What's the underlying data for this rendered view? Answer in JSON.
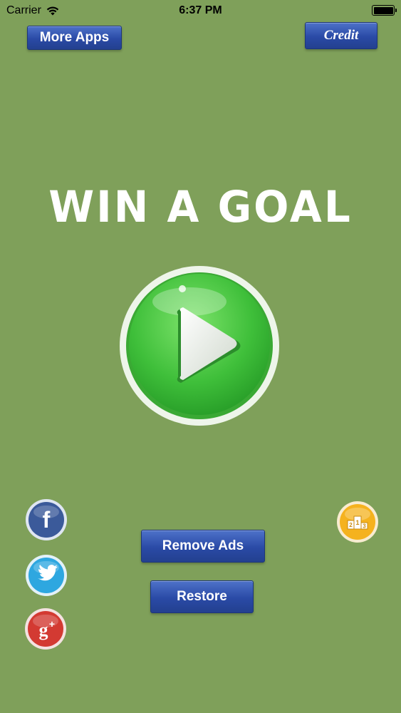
{
  "status_bar": {
    "carrier": "Carrier",
    "time": "6:37 PM"
  },
  "top_buttons": {
    "more_apps_label": "More Apps",
    "credit_label": "Credit"
  },
  "game": {
    "title": "WIN A GOAL"
  },
  "bottom_buttons": {
    "remove_ads_label": "Remove Ads",
    "restore_label": "Restore"
  },
  "icons": {
    "facebook": "facebook-icon",
    "twitter": "twitter-icon",
    "google_plus": "google-plus-icon",
    "leaderboard": "leaderboard-podium-icon",
    "play": "play-icon"
  },
  "colors": {
    "background": "#7fa05a",
    "button_blue": "#2a4aa6",
    "play_green": "#3fbf3a",
    "facebook": "#3b5a9a",
    "twitter": "#2ea7e0",
    "google_plus": "#d33a32",
    "leaderboard": "#f5b21e"
  }
}
